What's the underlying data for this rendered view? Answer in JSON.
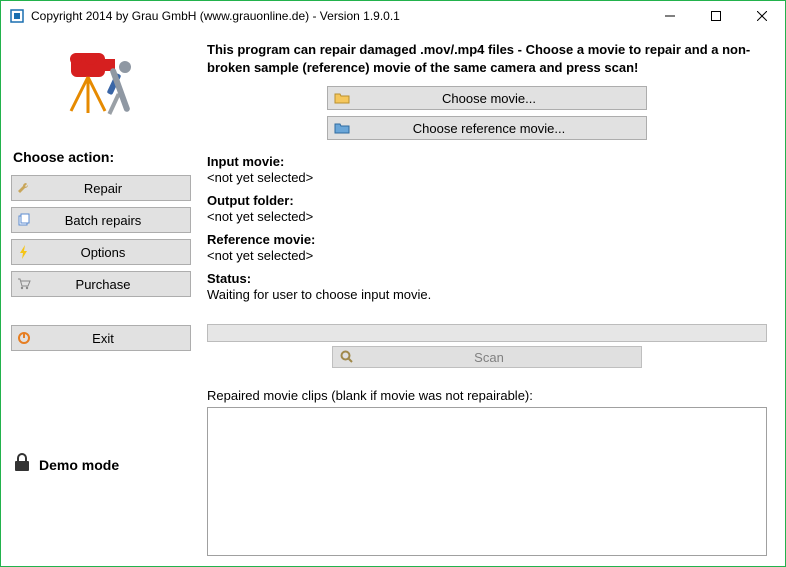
{
  "title": "Copyright 2014 by Grau GmbH (www.grauonline.de) - Version 1.9.0.1",
  "sidebar": {
    "heading": "Choose action:",
    "repair": "Repair",
    "batch": "Batch repairs",
    "options": "Options",
    "purchase": "Purchase",
    "exit": "Exit",
    "demo": "Demo mode"
  },
  "main": {
    "intro": "This program can repair damaged .mov/.mp4 files - Choose a movie to repair and a non-broken sample (reference) movie of the same camera and press scan!",
    "choose_movie": "Choose movie...",
    "choose_ref": "Choose reference movie...",
    "input_label": "Input movie:",
    "input_value": "<not yet selected>",
    "output_label": "Output folder:",
    "output_value": "<not yet selected>",
    "ref_label": "Reference movie:",
    "ref_value": "<not yet selected>",
    "status_label": "Status:",
    "status_value": "Waiting for user to choose input movie.",
    "scan": "Scan",
    "clips_label": "Repaired movie clips (blank if movie was not repairable):"
  }
}
